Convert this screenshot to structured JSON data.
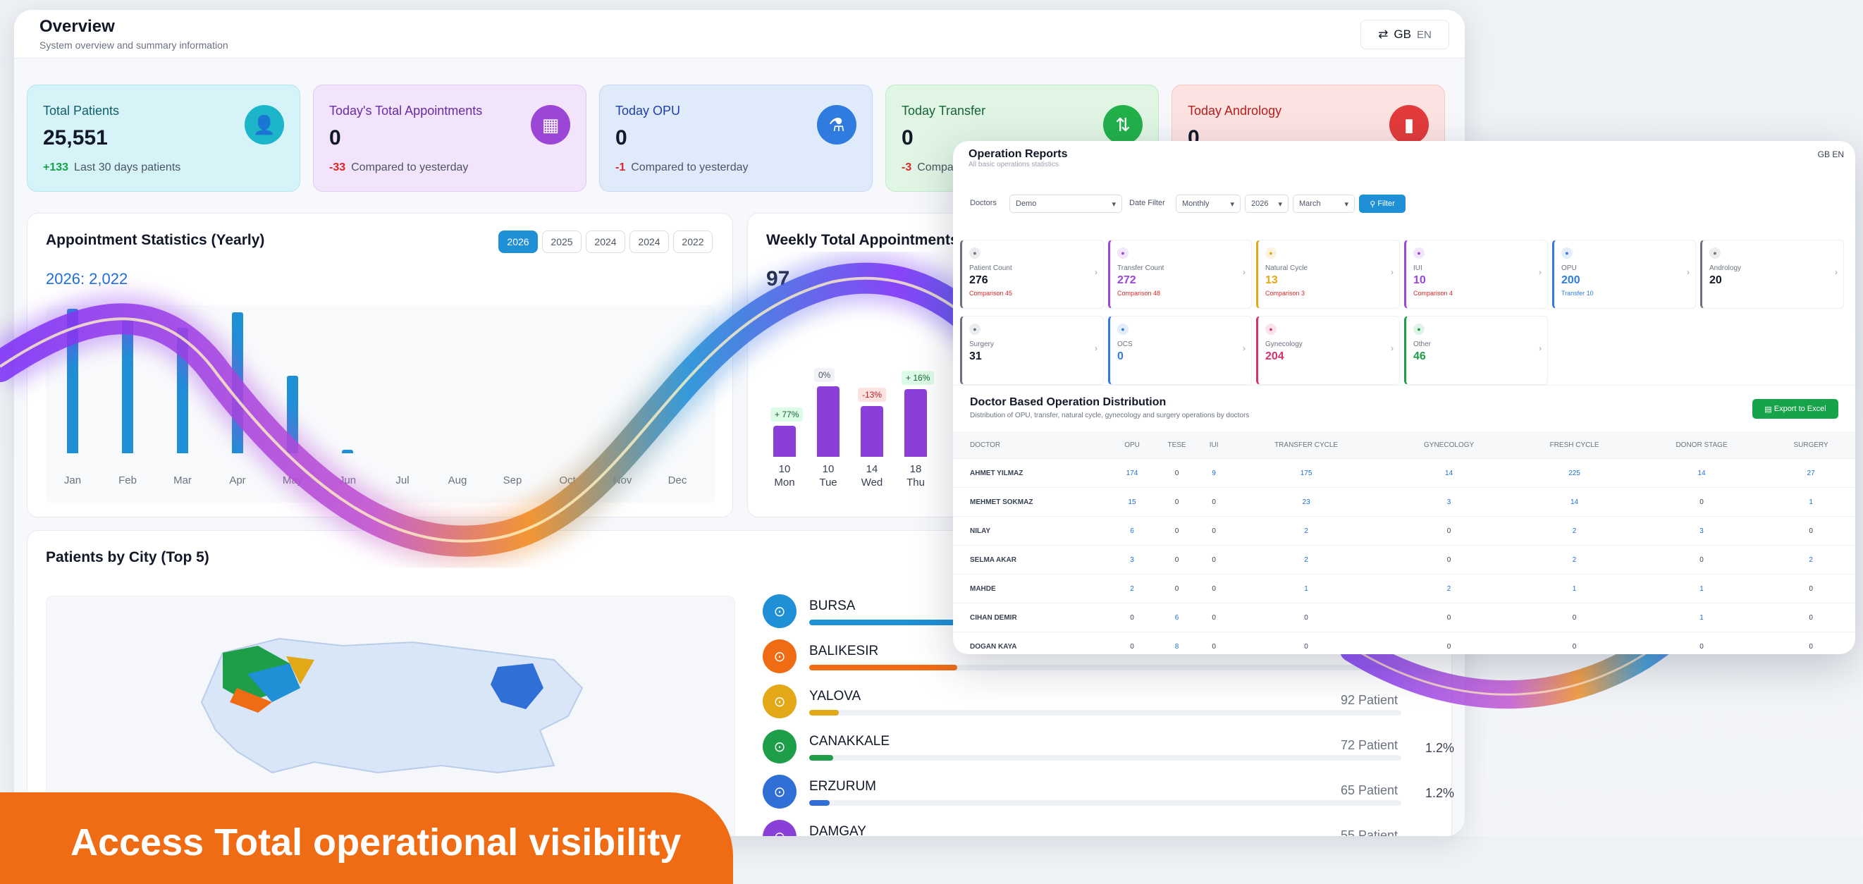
{
  "header": {
    "title": "Overview",
    "subtitle": "System overview and summary information",
    "lang_code": "GB",
    "lang_text": "EN"
  },
  "stats": [
    {
      "label": "Total Patients",
      "value": "25,551",
      "delta": "+133",
      "note": "Last 30 days patients",
      "icon": "users-icon",
      "color": "#1cb5c9"
    },
    {
      "label": "Today's Total Appointments",
      "value": "0",
      "delta": "-33",
      "note": "Compared to yesterday",
      "icon": "calendar-icon",
      "color": "#9b46d6"
    },
    {
      "label": "Today OPU",
      "value": "0",
      "delta": "-1",
      "note": "Compared to yesterday",
      "icon": "flask-icon",
      "color": "#2f7be0"
    },
    {
      "label": "Today Transfer",
      "value": "0",
      "delta": "-3",
      "note": "Compared to yesterday",
      "icon": "transfer-icon",
      "color": "#22b04b"
    },
    {
      "label": "Today Andrology",
      "value": "0",
      "delta": "",
      "note": "",
      "icon": "tube-icon",
      "color": "#e23b3b"
    }
  ],
  "appointments": {
    "title": "Appointment Statistics (Yearly)",
    "years": [
      "2026",
      "2025",
      "2024",
      "2024",
      "2022"
    ],
    "summary": "2026: 2,022",
    "months": [
      "Jan",
      "Feb",
      "Mar",
      "Apr",
      "May",
      "Jun",
      "Jul",
      "Aug",
      "Sep",
      "Oct",
      "Nov",
      "Dec"
    ],
    "values": [
      205,
      190,
      178,
      200,
      110,
      5,
      0,
      0,
      0,
      0,
      0,
      0
    ]
  },
  "weekly": {
    "title": "Weekly Total Appointments",
    "total": "97",
    "days": [
      {
        "num": "10",
        "day": "Mon",
        "value": 11,
        "tag": "+ 77%"
      },
      {
        "num": "10",
        "day": "Tue",
        "value": 25,
        "tag": "0%"
      },
      {
        "num": "14",
        "day": "Wed",
        "value": 18,
        "tag": "-13%"
      },
      {
        "num": "18",
        "day": "Thu",
        "value": 24,
        "tag": "+ 16%"
      }
    ]
  },
  "cities": {
    "title": "Patients by City (Top 5)",
    "rows": [
      {
        "name": "BURSA",
        "fill": 1.0,
        "color": "#1f8fd6",
        "count": "",
        "pct": ""
      },
      {
        "name": "BALIKESIR",
        "fill": 0.25,
        "color": "#ef6c15",
        "count": "",
        "pct": ""
      },
      {
        "name": "YALOVA",
        "fill": 0.05,
        "color": "#e2a817",
        "count": "92 Patient",
        "pct": ""
      },
      {
        "name": "CANAKKALE",
        "fill": 0.04,
        "color": "#1f9e4a",
        "count": "72 Patient",
        "pct": "1.2%"
      },
      {
        "name": "ERZURUM",
        "fill": 0.035,
        "color": "#2f6fd6",
        "count": "65 Patient",
        "pct": "1.2%"
      },
      {
        "name": "DAMGAY",
        "fill": 0.03,
        "color": "#8b3fd9",
        "count": "55 Patient",
        "pct": ""
      }
    ]
  },
  "operation": {
    "title": "Operation Reports",
    "subtitle": "All basic operations statistics",
    "lang": "GB EN",
    "filters": {
      "doctors_label": "Doctors",
      "doctor": "Demo",
      "date_label": "Date Filter",
      "period": "Monthly",
      "year": "2026",
      "month": "March",
      "filter_button": "Filter"
    },
    "cards": [
      {
        "label": "Patient Count",
        "value": "276",
        "sub": "Comparison 45",
        "color": "#6b7280"
      },
      {
        "label": "Transfer Count",
        "value": "272",
        "sub": "Comparison 48",
        "color": "#9b46d6"
      },
      {
        "label": "Natural Cycle",
        "value": "13",
        "sub": "Comparison 3",
        "color": "#e2a817"
      },
      {
        "label": "IUI",
        "value": "10",
        "sub": "Comparison 4",
        "color": "#9b46d6"
      },
      {
        "label": "OPU",
        "value": "200",
        "sub": "Transfer 10",
        "color": "#2f7be0"
      },
      {
        "label": "Andrology",
        "value": "20",
        "sub": "",
        "color": "#6b7280"
      },
      {
        "label": "Surgery",
        "value": "31",
        "sub": "",
        "color": "#6b7280"
      },
      {
        "label": "OCS",
        "value": "0",
        "sub": "",
        "color": "#2f7be0"
      },
      {
        "label": "Gynecology",
        "value": "204",
        "sub": "",
        "color": "#d6336c"
      },
      {
        "label": "Other",
        "value": "46",
        "sub": "",
        "color": "#1f9e4a"
      }
    ],
    "dist_title": "Doctor Based Operation Distribution",
    "dist_sub": "Distribution of OPU, transfer, natural cycle, gynecology and surgery operations by doctors",
    "export": "Export to Excel",
    "columns": [
      "DOCTOR",
      "OPU",
      "TESE",
      "IUI",
      "TRANSFER CYCLE",
      "GYNECOLOGY",
      "FRESH CYCLE",
      "DONOR STAGE",
      "SURGERY"
    ],
    "rows": [
      [
        "AHMET YILMAZ",
        "174",
        "0",
        "9",
        "175",
        "14",
        "225",
        "14",
        "27"
      ],
      [
        "MEHMET SOKMAZ",
        "15",
        "0",
        "0",
        "23",
        "3",
        "14",
        "0",
        "1"
      ],
      [
        "NILAY",
        "6",
        "0",
        "0",
        "2",
        "0",
        "2",
        "3",
        "0"
      ],
      [
        "SELMA AKAR",
        "3",
        "0",
        "0",
        "2",
        "0",
        "2",
        "0",
        "2"
      ],
      [
        "MAHDE",
        "2",
        "0",
        "0",
        "1",
        "2",
        "1",
        "1",
        "0"
      ],
      [
        "CIHAN DEMIR",
        "0",
        "6",
        "0",
        "0",
        "0",
        "0",
        "1",
        "0"
      ],
      [
        "DOGAN KAYA",
        "0",
        "8",
        "0",
        "0",
        "0",
        "0",
        "0",
        "0"
      ]
    ]
  },
  "banner": {
    "text": "Access Total operational visibility"
  }
}
